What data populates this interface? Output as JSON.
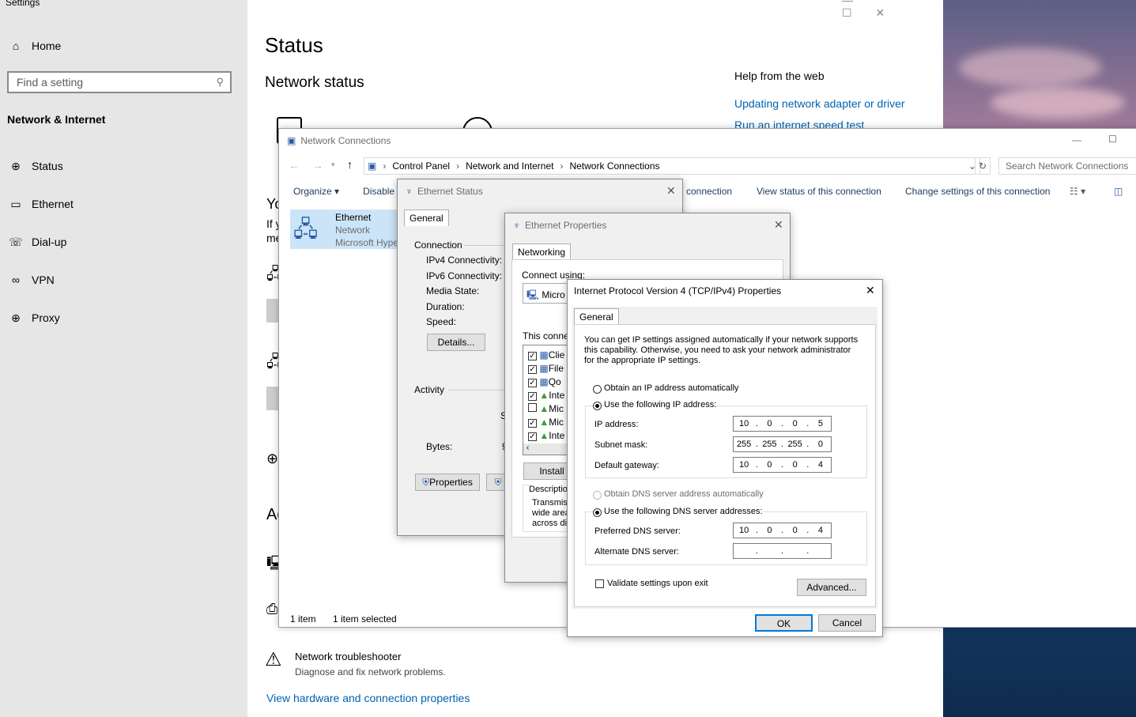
{
  "settings": {
    "window_title": "Settings",
    "home": "Home",
    "search_placeholder": "Find a setting",
    "category": "Network & Internet",
    "nav": [
      "Status",
      "Ethernet",
      "Dial-up",
      "VPN",
      "Proxy"
    ],
    "page_title": "Status",
    "network_status": "Network status",
    "help_title": "Help from the web",
    "help_link1": "Updating network adapter or driver",
    "help_link2": "Run an internet speed test",
    "partial_text_you": "Yo",
    "partial_text_if": "If y",
    "partial_text_me": "me",
    "partial_text_ad": "Ad",
    "troubleshooter_title": "Network troubleshooter",
    "troubleshooter_desc": "Diagnose and fix network problems.",
    "hw_link": "View hardware and connection properties"
  },
  "network_connections": {
    "title": "Network Connections",
    "breadcrumb": [
      "Control Panel",
      "Network and Internet",
      "Network Connections"
    ],
    "search_placeholder": "Search Network Connections",
    "cmd_organize": "Organize",
    "cmd_disable": "Disable",
    "cmd_connection": "connection",
    "cmd_view_status": "View status of this connection",
    "cmd_change": "Change settings of this connection",
    "item_name": "Ethernet",
    "item_network": "Network",
    "item_adapter": "Microsoft Hype",
    "status_items": "1 item",
    "status_selected": "1 item selected"
  },
  "ethernet_status": {
    "title": "Ethernet Status",
    "tab": "General",
    "connection": "Connection",
    "ipv4": "IPv4 Connectivity:",
    "ipv6": "IPv6 Connectivity:",
    "media": "Media State:",
    "duration": "Duration:",
    "speed": "Speed:",
    "details": "Details...",
    "activity": "Activity",
    "s_partial": "S",
    "bytes": "Bytes:",
    "bytes_partial": "9",
    "properties": "Properties"
  },
  "ethernet_properties": {
    "title": "Ethernet Properties",
    "tab": "Networking",
    "connect_using": "Connect using:",
    "adapter_partial": "Micro",
    "this_conn": "This connec",
    "items": [
      {
        "label": "Clie",
        "checked": true
      },
      {
        "label": "File",
        "checked": true
      },
      {
        "label": "Qo",
        "checked": true
      },
      {
        "label": "Inte",
        "checked": true
      },
      {
        "label": "Mic",
        "checked": false
      },
      {
        "label": "Mic",
        "checked": true
      },
      {
        "label": "Inte",
        "checked": true
      }
    ],
    "install": "Install",
    "description": "Description",
    "desc_line1": "Transmiss",
    "desc_line2": "wide area",
    "desc_line3": "across div"
  },
  "ipv4": {
    "title": "Internet Protocol Version 4 (TCP/IPv4) Properties",
    "tab": "General",
    "intro": "You can get IP settings assigned automatically if your network supports this capability. Otherwise, you need to ask your network administrator for the appropriate IP settings.",
    "auto_ip": "Obtain an IP address automatically",
    "manual_ip": "Use the following IP address:",
    "ip_label": "IP address:",
    "ip": [
      "10",
      "0",
      "0",
      "5"
    ],
    "subnet_label": "Subnet mask:",
    "subnet": [
      "255",
      "255",
      "255",
      "0"
    ],
    "gateway_label": "Default gateway:",
    "gateway": [
      "10",
      "0",
      "0",
      "4"
    ],
    "auto_dns": "Obtain DNS server address automatically",
    "manual_dns": "Use the following DNS server addresses:",
    "pref_dns_label": "Preferred DNS server:",
    "pref_dns": [
      "10",
      "0",
      "0",
      "4"
    ],
    "alt_dns_label": "Alternate DNS server:",
    "alt_dns": [
      "",
      "",
      "",
      ""
    ],
    "validate": "Validate settings upon exit",
    "advanced": "Advanced...",
    "ok": "OK",
    "cancel": "Cancel"
  }
}
